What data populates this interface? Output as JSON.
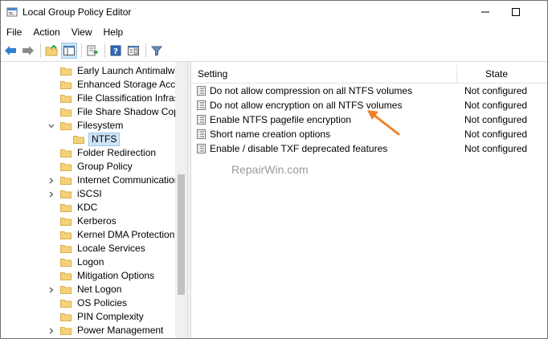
{
  "window": {
    "title": "Local Group Policy Editor"
  },
  "menu": [
    "File",
    "Action",
    "View",
    "Help"
  ],
  "colors": {
    "accent": "#f08127",
    "selection": "#cce4f7",
    "folder": "#f5d27a"
  },
  "tree": {
    "items": [
      {
        "label": "Early Launch Antimalwar",
        "chevron": "none",
        "indent": 0
      },
      {
        "label": "Enhanced Storage Access",
        "chevron": "none",
        "indent": 0
      },
      {
        "label": "File Classification Infrastr",
        "chevron": "none",
        "indent": 0
      },
      {
        "label": "File Share Shadow Copy I",
        "chevron": "none",
        "indent": 0
      },
      {
        "label": "Filesystem",
        "chevron": "down",
        "indent": 0
      },
      {
        "label": "NTFS",
        "chevron": "none",
        "indent": 1,
        "selected": true
      },
      {
        "label": "Folder Redirection",
        "chevron": "none",
        "indent": 0
      },
      {
        "label": "Group Policy",
        "chevron": "none",
        "indent": 0
      },
      {
        "label": "Internet Communication",
        "chevron": "right",
        "indent": 0
      },
      {
        "label": "iSCSI",
        "chevron": "right",
        "indent": 0
      },
      {
        "label": "KDC",
        "chevron": "none",
        "indent": 0
      },
      {
        "label": "Kerberos",
        "chevron": "none",
        "indent": 0
      },
      {
        "label": "Kernel DMA Protection",
        "chevron": "none",
        "indent": 0
      },
      {
        "label": "Locale Services",
        "chevron": "none",
        "indent": 0
      },
      {
        "label": "Logon",
        "chevron": "none",
        "indent": 0
      },
      {
        "label": "Mitigation Options",
        "chevron": "none",
        "indent": 0
      },
      {
        "label": "Net Logon",
        "chevron": "right",
        "indent": 0
      },
      {
        "label": "OS Policies",
        "chevron": "none",
        "indent": 0
      },
      {
        "label": "PIN Complexity",
        "chevron": "none",
        "indent": 0
      },
      {
        "label": "Power Management",
        "chevron": "right",
        "indent": 0
      }
    ]
  },
  "list": {
    "columns": {
      "setting": "Setting",
      "state": "State"
    },
    "rows": [
      {
        "setting": "Do not allow compression on all NTFS volumes",
        "state": "Not configured"
      },
      {
        "setting": "Do not allow encryption on all NTFS volumes",
        "state": "Not configured"
      },
      {
        "setting": "Enable NTFS pagefile encryption",
        "state": "Not configured"
      },
      {
        "setting": "Short name creation options",
        "state": "Not configured"
      },
      {
        "setting": "Enable / disable TXF deprecated features",
        "state": "Not configured"
      }
    ]
  },
  "watermark": "RepairWin.com"
}
